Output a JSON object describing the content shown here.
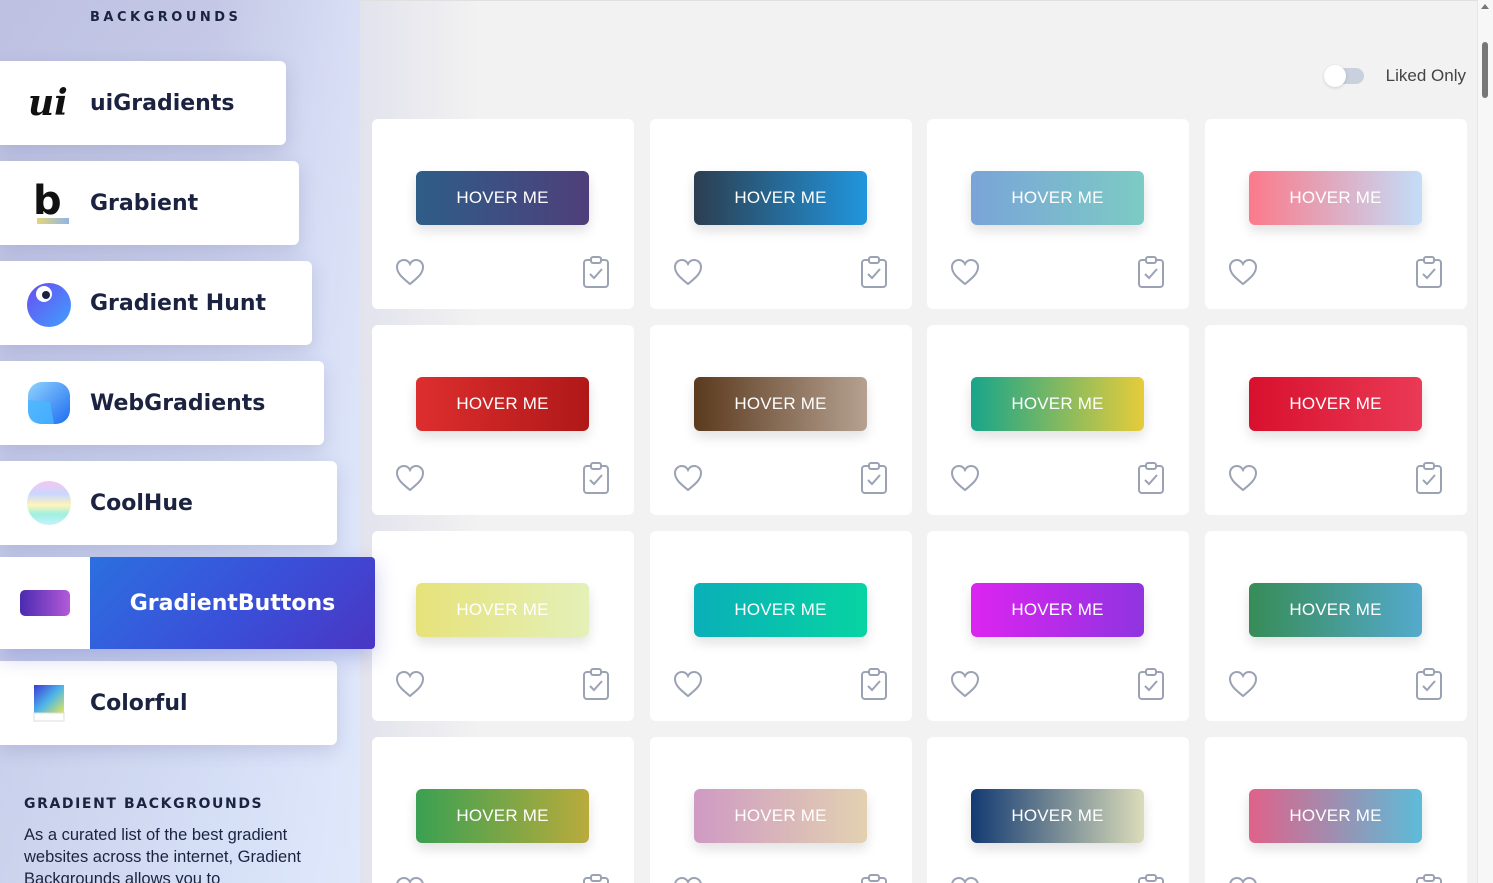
{
  "brand": {
    "subtitle": "BACKGROUNDS"
  },
  "sidebar": {
    "items": [
      {
        "label": "uiGradients"
      },
      {
        "label": "Grabient"
      },
      {
        "label": "Gradient Hunt"
      },
      {
        "label": "WebGradients"
      },
      {
        "label": "CoolHue"
      },
      {
        "label": "GradientButtons",
        "active": true
      },
      {
        "label": "Colorful"
      }
    ],
    "about_title": "GRADIENT BACKGROUNDS",
    "about_text": "As a curated list of the best gradient websites across the internet, Gradient Backgrounds allows you to"
  },
  "filter": {
    "label": "Liked Only",
    "checked": false
  },
  "buttons": {
    "label": "HOVER ME",
    "gradients": [
      [
        "#2f5d88",
        "#4e3f7a"
      ],
      [
        "#2c3e50",
        "#2196de"
      ],
      [
        "#7aa4d8",
        "#7ccbc4"
      ],
      [
        "#fb7a8a",
        "#c3ddf8"
      ],
      [
        "#dd2e2e",
        "#b01818"
      ],
      [
        "#5b3a1e",
        "#b5a191"
      ],
      [
        "#18a58a",
        "#e6cc3a"
      ],
      [
        "#d8102e",
        "#ea3a55"
      ],
      [
        "#e6e27a",
        "#e4f0b8"
      ],
      [
        "#0aafb8",
        "#07d4a2"
      ],
      [
        "#dc24f0",
        "#8f34e0"
      ],
      [
        "#378c57",
        "#54aacc"
      ],
      [
        "#3aa052",
        "#b9ab3c"
      ],
      [
        "#cf9ac3",
        "#e2d1b1"
      ],
      [
        "#133a72",
        "#dbdcb9"
      ],
      [
        "#df628a",
        "#5cbcd8"
      ]
    ]
  }
}
